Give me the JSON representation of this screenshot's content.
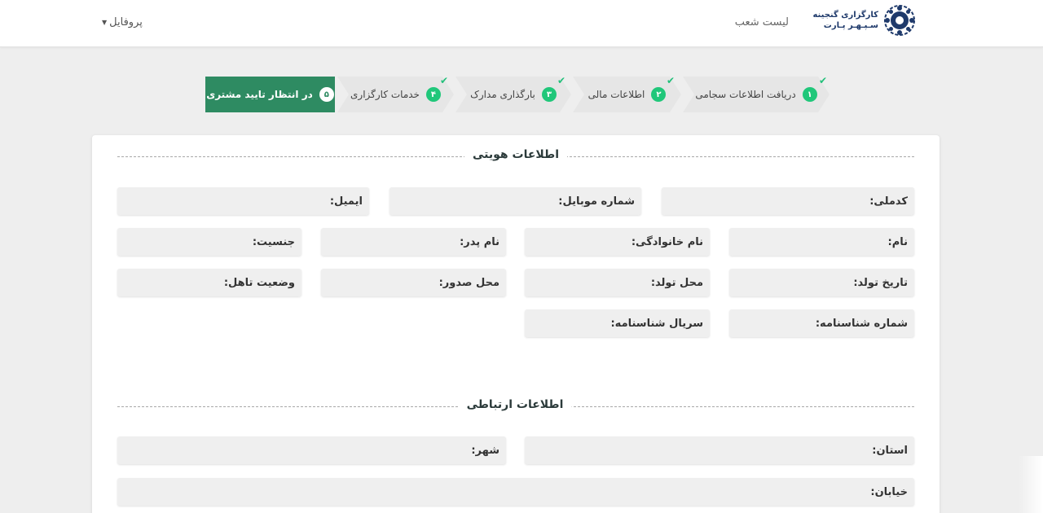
{
  "header": {
    "logo_line1": "کارگزاری گنجینه",
    "logo_line2": "سـپـهـر پـارت",
    "nav_branches": "لیست شعب",
    "profile": "پروفایل"
  },
  "stepper": {
    "steps": [
      {
        "num": "۱",
        "label": "دریافت اطلاعات سجامی",
        "done": true
      },
      {
        "num": "۲",
        "label": "اطلاعات مالی",
        "done": true
      },
      {
        "num": "۳",
        "label": "بارگذاری مدارک",
        "done": true
      },
      {
        "num": "۴",
        "label": "خدمات کارگزاری",
        "done": true
      },
      {
        "num": "۵",
        "label": "در انتظار تایید مشتری",
        "active": true
      }
    ]
  },
  "identity": {
    "title": "اطلاعات هویتی",
    "fields": {
      "national_code": {
        "label": "کدملی:",
        "value": ""
      },
      "mobile": {
        "label": "شماره موبایل:",
        "value": ""
      },
      "email": {
        "label": "ایمیل:",
        "value": ""
      },
      "first_name": {
        "label": "نام:",
        "value": ""
      },
      "last_name": {
        "label": "نام خانوادگی:",
        "value": ""
      },
      "father_name": {
        "label": "نام پدر:",
        "value": ""
      },
      "gender": {
        "label": "جنسیت:",
        "value": ""
      },
      "birth_date": {
        "label": "تاریخ تولد:",
        "value": ""
      },
      "birth_place": {
        "label": "محل تولد:",
        "value": ""
      },
      "issue_place": {
        "label": "محل صدور:",
        "value": ""
      },
      "marital_status": {
        "label": "وضعیت تاهل:",
        "value": ""
      },
      "id_number": {
        "label": "شماره شناسنامه:",
        "value": ""
      },
      "id_serial": {
        "label": "سریال شناسنامه:",
        "value": ""
      }
    }
  },
  "contact": {
    "title": "اطلاعات ارتباطی",
    "fields": {
      "province": {
        "label": "استان:",
        "value": ""
      },
      "city": {
        "label": "شهر:",
        "value": ""
      },
      "street": {
        "label": "خیابان:",
        "value": ""
      }
    }
  },
  "colors": {
    "accent": "#2e8b62",
    "step_badge": "#20c77a",
    "check": "#23c07a"
  }
}
